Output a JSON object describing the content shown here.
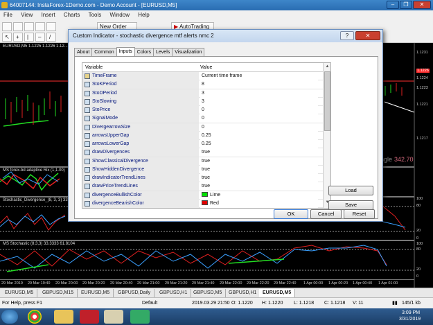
{
  "window": {
    "title": "64007144: InstaForex-1Demo.com - Demo Account - [EURUSD,M5]",
    "min": "–",
    "max": "❐",
    "close": "✕"
  },
  "menu": [
    "File",
    "View",
    "Insert",
    "Charts",
    "Tools",
    "Window",
    "Help"
  ],
  "toolbar": {
    "new_order": "New Order",
    "autotrading": "AutoTrading"
  },
  "chart": {
    "main_title": "EURUSD,M5 1.1225 1.1226 1.12...",
    "price_labels": [
      "1.1231",
      "1.1226",
      "1.1224",
      "1.1223",
      "1.1221",
      "1.1217"
    ],
    "indicator_value_label": "ngle",
    "indicator_value": "342.70",
    "sub1_title": "MS forex-bd adaptive Rix (1,1.00)",
    "sub2_title": "Stochastic_Divergence_(8, 3, 3) 33",
    "sub2_levels": [
      "100",
      "80",
      "20",
      "0"
    ],
    "sub3_title": "MS Stochastic (8,3,3) 33.3333 61.8104",
    "sub3_levels": [
      "100",
      "80",
      "20",
      "0"
    ],
    "time_labels": [
      "29 Mar 2019",
      "29 Mar 19:40",
      "29 Mar 20:00",
      "29 Mar 20:20",
      "29 Mar 20:40",
      "29 Mar 21:00",
      "29 Mar 21:20",
      "29 Mar 21:40",
      "29 Mar 22:00",
      "29 Mar 22:20",
      "29 Mar 22:40",
      "1 Apr 00:00",
      "1 Apr 00:20",
      "1 Apr 00:40",
      "1 Apr 01:00"
    ],
    "colors": {
      "up": "#22dd22",
      "down": "#e02020",
      "blue_line": "#3aa0ff"
    }
  },
  "tabs": [
    "EURUSD,M5",
    "GBPUSD,M15",
    "EURUSD,M5",
    "GBPUSD,Daily",
    "GBPUSD,H1",
    "GBPUSD,M5",
    "GBPUSD,H1",
    "EURUSD,M5"
  ],
  "active_tab_index": 7,
  "status": {
    "help": "For Help, press F1",
    "profile": "Default",
    "datetime": "2019.03.29 21:50",
    "open": "O: 1.1220",
    "high": "H: 1.1220",
    "low": "L: 1.1218",
    "close": "C: 1.1218",
    "volume": "V: 11",
    "traffic": "145/1 kb"
  },
  "taskbar": {
    "time": "3:09 PM",
    "date": "3/31/2019"
  },
  "dialog": {
    "title": "Custom Indicator - stochastic divergence mtf alerts nmc 2",
    "help_btn": "?",
    "close_btn": "✕",
    "tabs": [
      "About",
      "Common",
      "Inputs",
      "Colors",
      "Levels",
      "Visualization"
    ],
    "active_tab": 2,
    "col_variable": "Variable",
    "col_value": "Value",
    "params": [
      {
        "name": "TimeFrame",
        "value": "Current time frame",
        "type": "t"
      },
      {
        "name": "StoKPeriod",
        "value": "8",
        "type": "n"
      },
      {
        "name": "StoDPeriod",
        "value": "3",
        "type": "n"
      },
      {
        "name": "StoSlowing",
        "value": "3",
        "type": "n"
      },
      {
        "name": "StoPrice",
        "value": "0",
        "type": "n"
      },
      {
        "name": "SignalMode",
        "value": "0",
        "type": "n"
      },
      {
        "name": "DivergearrowSize",
        "value": "0",
        "type": "n"
      },
      {
        "name": "arrowsUpperGap",
        "value": "0.25",
        "type": "n"
      },
      {
        "name": "arrowsLowerGap",
        "value": "0.25",
        "type": "n"
      },
      {
        "name": "drawDivergences",
        "value": "true",
        "type": "b"
      },
      {
        "name": "ShowClassicalDivergence",
        "value": "true",
        "type": "b"
      },
      {
        "name": "ShowHiddenDivergence",
        "value": "true",
        "type": "b"
      },
      {
        "name": "drawIndicatorTrendLines",
        "value": "true",
        "type": "b"
      },
      {
        "name": "drawPriceTrendLines",
        "value": "true",
        "type": "b"
      },
      {
        "name": "divergenceBullishColor",
        "value": "Lime",
        "type": "c",
        "color": "#00e000"
      },
      {
        "name": "divergenceBearishColor",
        "value": "Red",
        "type": "c",
        "color": "#e00000"
      }
    ],
    "load": "Load",
    "save": "Save",
    "ok": "OK",
    "cancel": "Cancel",
    "reset": "Reset"
  }
}
